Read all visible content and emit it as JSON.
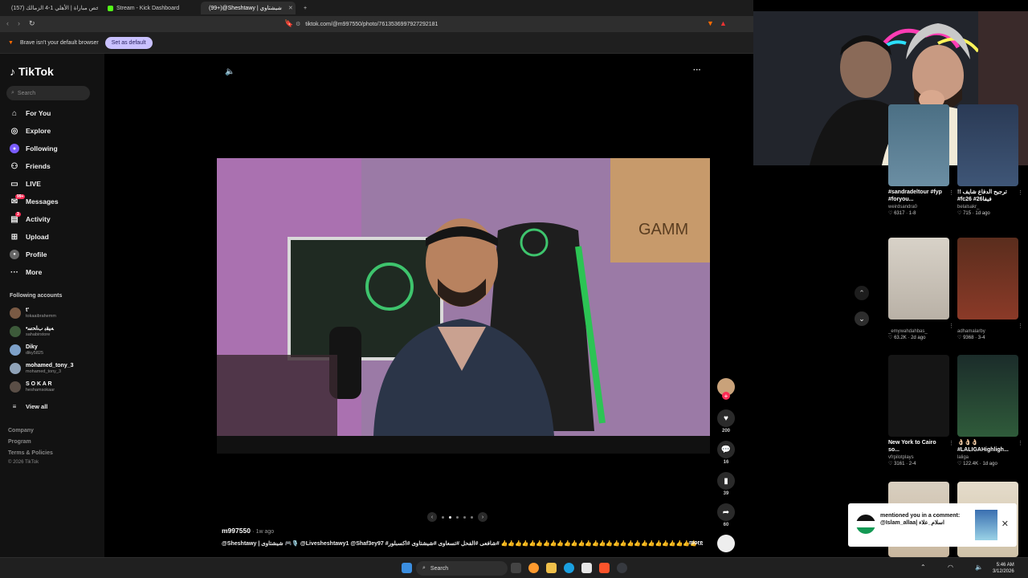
{
  "browser": {
    "tabs": [
      {
        "label": "(157) ملخص مباراة | الأهلي 1-4 الزمالك",
        "active": false,
        "favicon_color": "#ff0000"
      },
      {
        "label": "Stream - Kick Dashboard",
        "active": false,
        "favicon_color": "#53fc18"
      },
      {
        "label": "(99+)@Sheshtawy | شيشتاوي",
        "active": true,
        "favicon_color": "#ffffff"
      }
    ],
    "new_tab": "+",
    "url": "tiktok.com/@m997550/photo/7613536997927292181",
    "infobar_text": "Brave isn't your default browser",
    "set_default_label": "Set as default"
  },
  "sidebar": {
    "logo": "TikTok",
    "search_placeholder": "Search",
    "nav": [
      {
        "label": "For You",
        "icon": "home-icon"
      },
      {
        "label": "Explore",
        "icon": "compass-icon"
      },
      {
        "label": "Following",
        "icon": "following-icon"
      },
      {
        "label": "Friends",
        "icon": "friends-icon"
      },
      {
        "label": "LIVE",
        "icon": "live-icon"
      },
      {
        "label": "Messages",
        "icon": "message-icon",
        "badge": "99+"
      },
      {
        "label": "Activity",
        "icon": "activity-icon",
        "badge": "3"
      },
      {
        "label": "Upload",
        "icon": "upload-icon"
      },
      {
        "label": "Profile",
        "icon": "profile-icon"
      },
      {
        "label": "More",
        "icon": "more-icon"
      }
    ],
    "following_title": "Following accounts",
    "accounts": [
      {
        "name": "t'",
        "handle": "tokaaibrahemm"
      },
      {
        "name": "•ﻪﻴﻘﺑ ﺏﺎﺤﺳ",
        "handle": "sahabirstore"
      },
      {
        "name": "Diky",
        "handle": "diky5825"
      },
      {
        "name": "mohamed_tony_3",
        "handle": "mohamed_tony_3"
      },
      {
        "name": "S O K A R",
        "handle": "heshamsokaar"
      }
    ],
    "view_all": "View all",
    "footer": [
      "Company",
      "Program",
      "Terms & Policies"
    ],
    "copyright": "© 2026 TikTok"
  },
  "post": {
    "author": "m997550",
    "time": "· 1w ago",
    "caption": "@Sheshtawy | شيشتاوى 🎮🎙️ @Livesheshtawy1 @Shaf3ey97 #شافعى #الفحل #تسعاوى #شيشتاوى #اكسبلور# 👍👍👍👍👍👍👍👍👍👍👍👍👍👍👍👍👍👍👍👍👍👍👍👍👍👍👍👍 ...",
    "more_label": "more",
    "likes": "200",
    "comments": "16",
    "saves": "39",
    "shares": "60"
  },
  "recommendations": [
    {
      "title": "#sandradeltour #fyp #foryou...",
      "user": "weirdsandra0",
      "likes": "6317",
      "age": "1-8"
    },
    {
      "title": "!! ترجيح الدفاع شايف #fc26 #فيفا26",
      "user": "belalsakr_",
      "likes": "715",
      "age": "1d ago"
    },
    {
      "title": "",
      "user": "_emywahdahbas_",
      "likes": "63.2K",
      "age": "2d ago"
    },
    {
      "title": "",
      "user": "adhamalarby",
      "likes": "9368",
      "age": "3-4"
    },
    {
      "title": "New York to Cairo so...",
      "user": "vfrpilotplays",
      "likes": "3161",
      "age": "2-4"
    },
    {
      "title": "👌🏻👌🏻👌🏻 #LALIGAHighligh...",
      "user": "laliga",
      "likes": "122.4K",
      "age": "1d ago"
    }
  ],
  "toast": {
    "text": "mentioned you in a comment: @Islam_allaa| اسلام_علاء"
  },
  "taskbar": {
    "search_label": "Search",
    "time": "5:46 AM",
    "date": "3/12/2026"
  }
}
